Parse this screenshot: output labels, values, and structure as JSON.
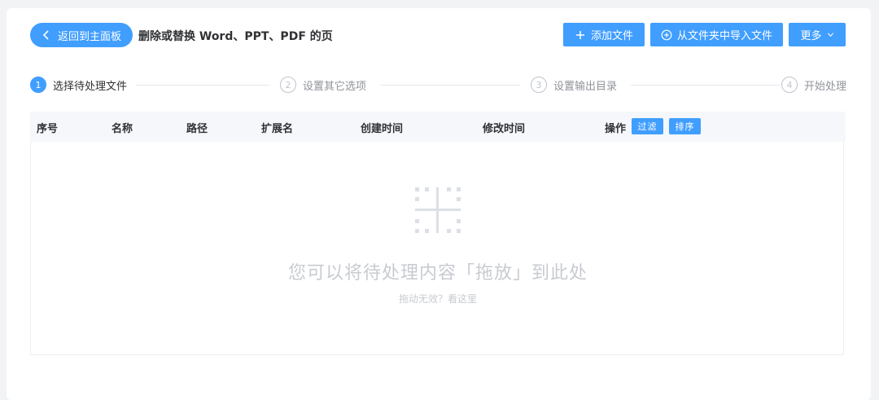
{
  "header": {
    "back_label": "返回到主面板",
    "title": "删除或替换 Word、PPT、PDF 的页",
    "add_file_label": "添加文件",
    "import_folder_label": "从文件夹中导入文件",
    "more_label": "更多"
  },
  "steps": [
    {
      "num": "1",
      "label": "选择待处理文件",
      "active": true
    },
    {
      "num": "2",
      "label": "设置其它选项",
      "active": false
    },
    {
      "num": "3",
      "label": "设置输出目录",
      "active": false
    },
    {
      "num": "4",
      "label": "开始处理",
      "active": false
    }
  ],
  "table": {
    "columns": [
      "序号",
      "名称",
      "路径",
      "扩展名",
      "创建时间",
      "修改时间",
      "操作"
    ],
    "filter_label": "过滤",
    "sort_label": "排序"
  },
  "empty": {
    "main": "您可以将待处理内容「拖放」到此处",
    "sub": "拖动无效？看这里"
  },
  "colors": {
    "accent": "#409eff",
    "muted_text": "#c8cbd0"
  }
}
